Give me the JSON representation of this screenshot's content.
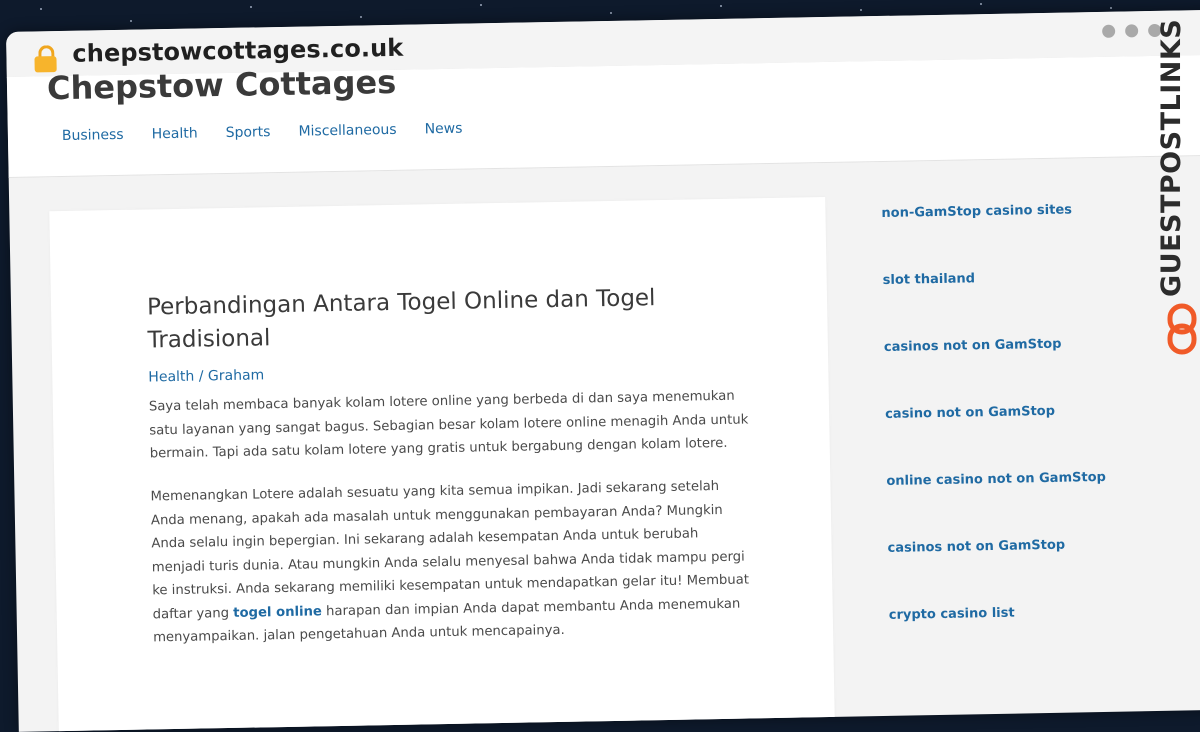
{
  "browser": {
    "url": "chepstowcottages.co.uk"
  },
  "site": {
    "title": "Chepstow Cottages",
    "nav": [
      "Business",
      "Health",
      "Sports",
      "Miscellaneous",
      "News"
    ]
  },
  "article": {
    "title": "Perbandingan Antara Togel Online dan Togel Tradisional",
    "meta_category": "Health",
    "meta_separator": " / ",
    "meta_author": "Graham",
    "paragraph1": "Saya telah membaca banyak kolam lotere online yang berbeda di dan saya menemukan satu layanan yang sangat bagus. Sebagian besar kolam lotere online menagih Anda untuk bermain. Tapi ada satu kolam lotere yang gratis untuk bergabung dengan kolam lotere.",
    "paragraph2_before": "Memenangkan Lotere adalah sesuatu yang kita semua impikan. Jadi sekarang setelah Anda menang, apakah ada masalah untuk menggunakan pembayaran Anda? Mungkin Anda selalu ingin bepergian. Ini sekarang adalah kesempatan Anda untuk berubah menjadi turis dunia. Atau mungkin Anda selalu menyesal bahwa Anda tidak mampu pergi ke instruksi. Anda sekarang memiliki kesempatan untuk mendapatkan gelar itu! Membuat daftar yang ",
    "paragraph2_link": "togel online",
    "paragraph2_after": " harapan dan impian Anda dapat membantu Anda menemukan menyampaikan. jalan pengetahuan Anda untuk mencapainya."
  },
  "sidebar": {
    "links": [
      "non-GamStop casino sites",
      "slot thailand",
      "casinos not on GamStop",
      "casino not on GamStop",
      "online casino not on GamStop",
      "casinos not on GamStop",
      "crypto casino list"
    ]
  },
  "watermark": {
    "text": "GUESTPOSTLINKS",
    "icon": "chain-link-icon",
    "color": "#f05a28"
  },
  "colors": {
    "link": "#1f6aa3",
    "lock": "#f7b42c",
    "background": "#0e1a2c"
  }
}
